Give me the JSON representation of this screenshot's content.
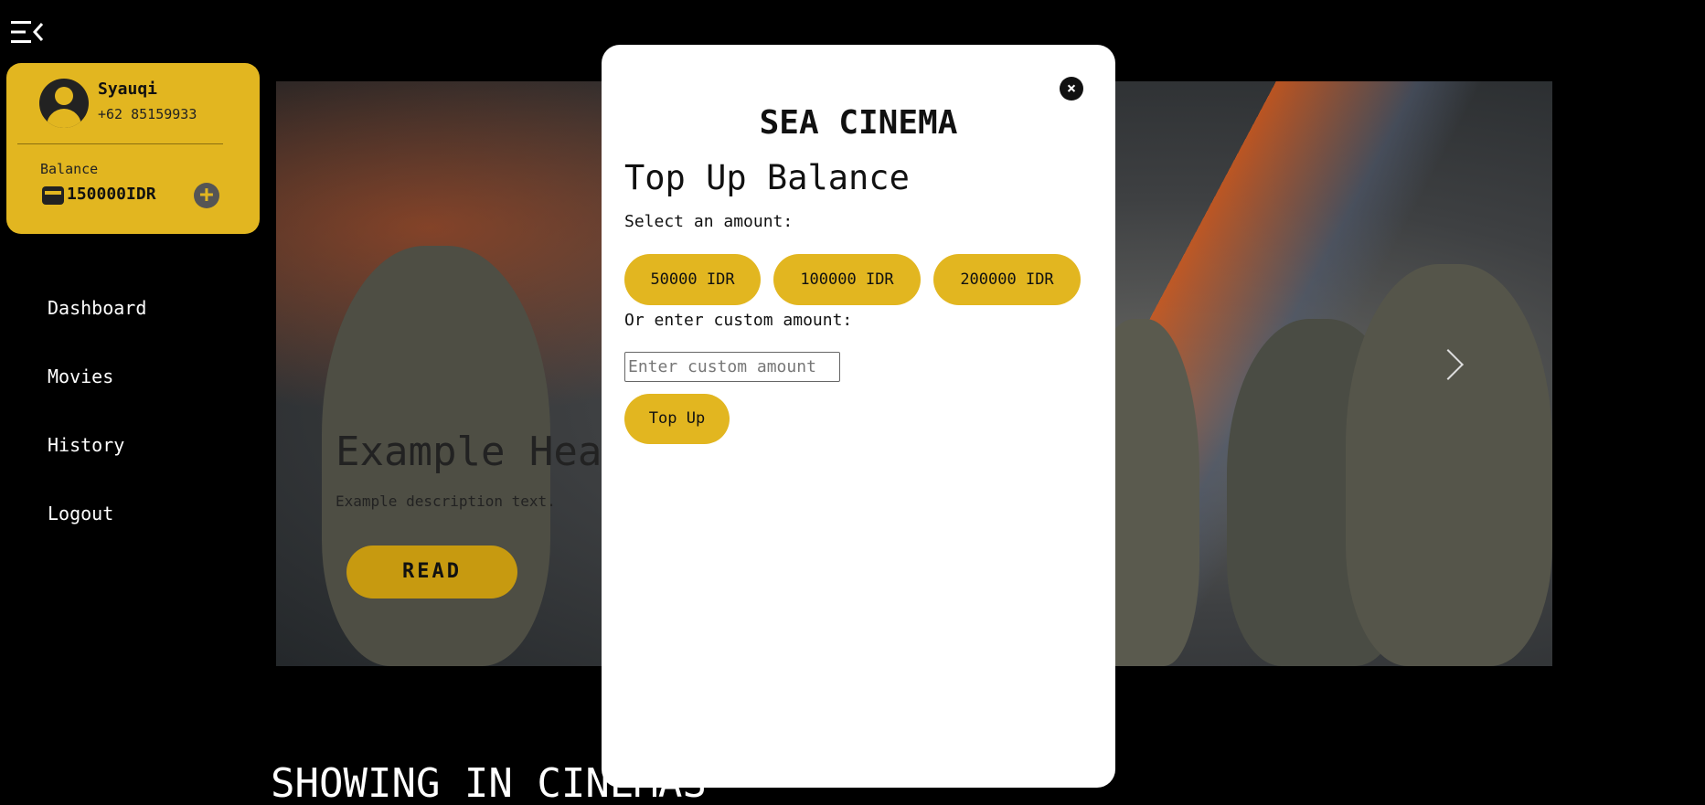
{
  "sidebar": {
    "user": {
      "name": "Syauqi",
      "phone": "+62 85159933"
    },
    "balance": {
      "label": "Balance",
      "value": "150000IDR"
    },
    "nav": [
      {
        "label": "Dashboard"
      },
      {
        "label": "Movies"
      },
      {
        "label": "History"
      },
      {
        "label": "Logout"
      }
    ]
  },
  "hero": {
    "heading": "Example Heading",
    "description": "Example description text.",
    "read_label": "READ"
  },
  "section": {
    "title": "SHOWING IN CINEMAS"
  },
  "modal": {
    "brand": "SEA CINEMA",
    "title": "Top Up Balance",
    "select_label": "Select an amount:",
    "amounts": [
      "50000 IDR",
      "100000 IDR",
      "200000 IDR"
    ],
    "custom_label": "Or enter custom amount:",
    "custom_placeholder": "Enter custom amount",
    "custom_value": "",
    "submit_label": "Top Up",
    "close_icon": "×"
  },
  "colors": {
    "accent": "#e2b620",
    "read_button": "#c79a10",
    "background": "#000000"
  }
}
